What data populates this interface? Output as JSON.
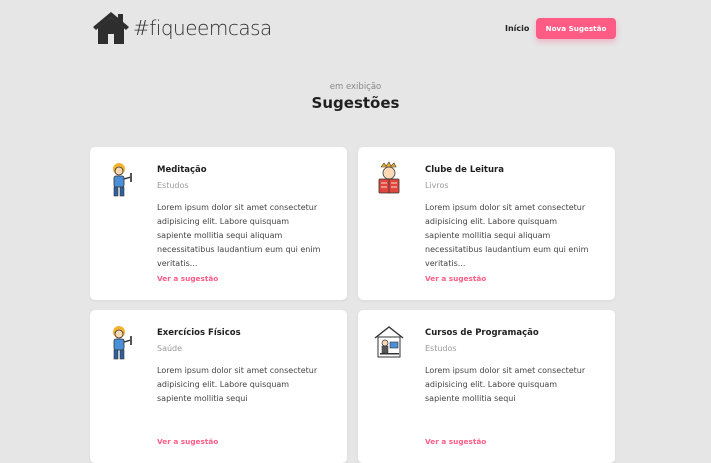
{
  "header": {
    "logo_text": "#fiqueemcasa",
    "nav_home": "Início",
    "new_button": "Nova Sugestão"
  },
  "section": {
    "subtitle": "em exibição",
    "title": "Sugestões"
  },
  "cards": [
    {
      "name": "Meditação",
      "category": "Estudos",
      "description": "Lorem ipsum dolor sit amet consectetur adipisicing elit. Labore quisquam sapiente mollitia sequi aliquam necessitatibus laudantium eum qui enim veritatis...",
      "link": "Ver a sugestão",
      "icon": "meditation-person-icon"
    },
    {
      "name": "Clube de Leitura",
      "category": "Livros",
      "description": "Lorem ipsum dolor sit amet consectetur adipisicing elit. Labore quisquam sapiente mollitia sequi aliquam necessitatibus laudantium eum qui enim veritatis...",
      "link": "Ver a sugestão",
      "icon": "reading-person-icon"
    },
    {
      "name": "Exercícios Físicos",
      "category": "Saúde",
      "description": "Lorem ipsum dolor sit amet consectetur adipisicing elit. Labore quisquam sapiente mollitia sequi",
      "link": "Ver a sugestão",
      "icon": "exercise-person-icon"
    },
    {
      "name": "Cursos de Programação",
      "category": "Estudos",
      "description": "Lorem ipsum dolor sit amet consectetur adipisicing elit. Labore quisquam sapiente mollitia sequi",
      "link": "Ver a sugestão",
      "icon": "programming-house-icon"
    }
  ],
  "colors": {
    "accent": "#ff5c85",
    "background": "#e6e6e6",
    "card": "#ffffff"
  }
}
